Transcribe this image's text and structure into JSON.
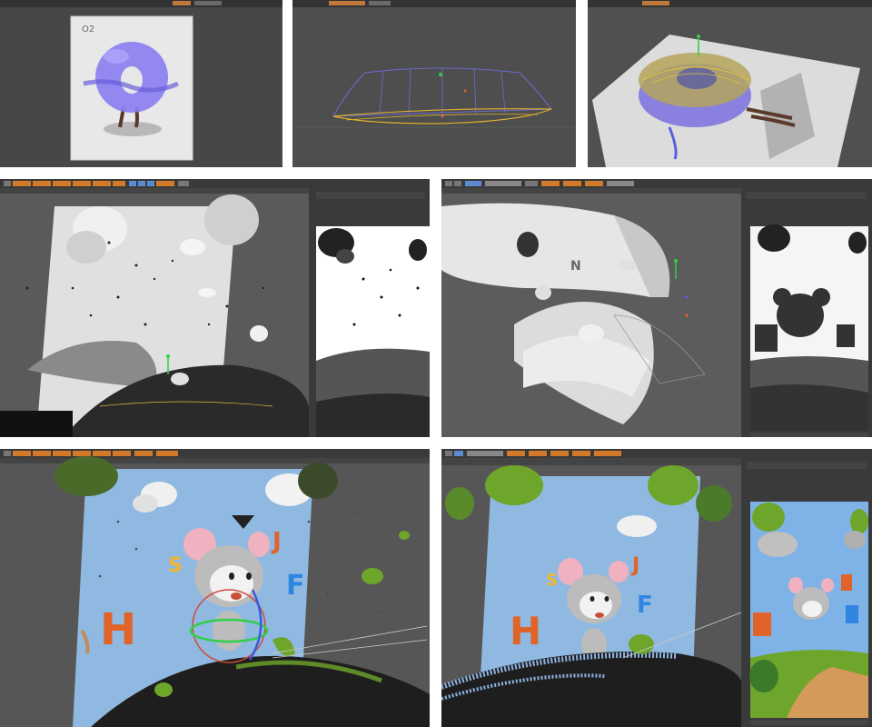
{
  "panels": [
    {
      "id": "p1",
      "card_label": "O2"
    },
    {
      "id": "p2"
    },
    {
      "id": "p3"
    },
    {
      "id": "p4"
    },
    {
      "id": "p5",
      "letter": "N"
    },
    {
      "id": "p6",
      "letters": [
        "H",
        "J",
        "F",
        "S"
      ]
    },
    {
      "id": "p7",
      "letters": [
        "H",
        "J",
        "F",
        "S"
      ]
    }
  ],
  "colors": {
    "ui_dark": "#3a3a3a",
    "viewport": "#4b4b4b",
    "toolbar_orange": "#d27a2a",
    "sky": "#8fb9e0",
    "letter_orange": "#e0642a",
    "letter_blue": "#2f86e0",
    "letter_yellow": "#f0b72e",
    "leaf_green": "#6ea52b",
    "torus_purple": "#8a7ff0"
  }
}
